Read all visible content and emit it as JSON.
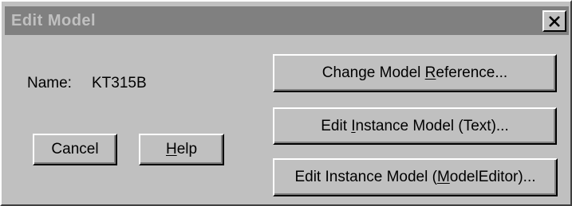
{
  "dialog": {
    "title": "Edit Model",
    "close_symbol": "close-icon"
  },
  "fields": {
    "name_label": "Name:",
    "name_value": "KT315B"
  },
  "buttons": {
    "change_ref": {
      "pre": "Change Model ",
      "key": "R",
      "post": "eference..."
    },
    "edit_text": {
      "pre": "Edit ",
      "key": "I",
      "post": "nstance Model (Text)..."
    },
    "edit_editor": {
      "pre": "Edit Instance Model (",
      "key": "M",
      "post": "odelEditor)..."
    },
    "cancel": {
      "label": "Cancel"
    },
    "help": {
      "pre": "",
      "key": "H",
      "post": "elp"
    }
  },
  "colors": {
    "face": "#c0c0c0",
    "titlebar_inactive": "#808080",
    "title_text_inactive": "#c0c0c0"
  }
}
